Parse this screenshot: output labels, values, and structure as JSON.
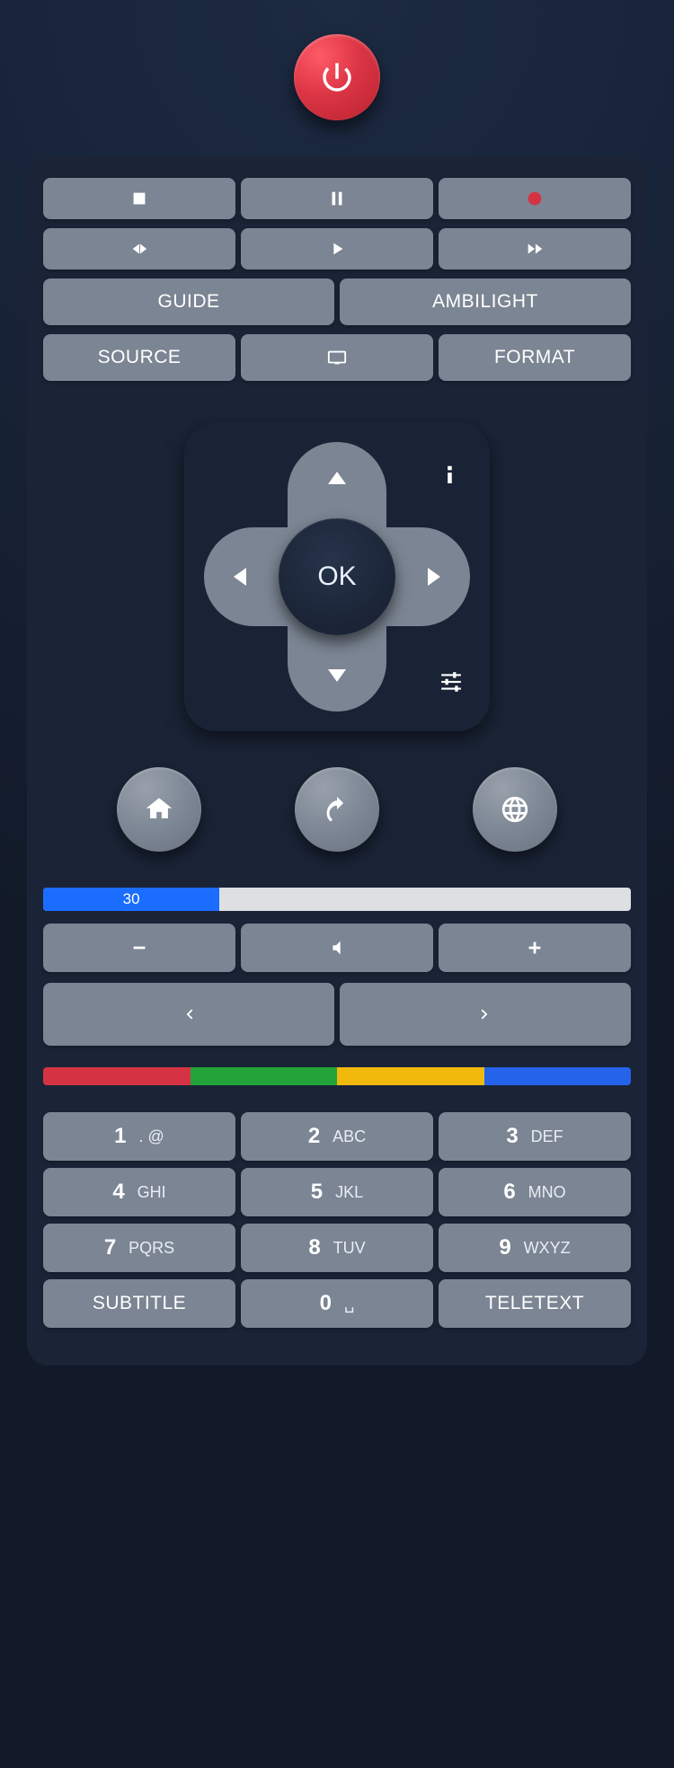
{
  "ok_label": "OK",
  "row3": {
    "guide": "GUIDE",
    "ambilight": "AMBILIGHT"
  },
  "row4": {
    "source": "SOURCE",
    "format": "FORMAT"
  },
  "volume": {
    "value": 30,
    "display": "30"
  },
  "keypad": {
    "k1": {
      "d": "1",
      "l": ". @"
    },
    "k2": {
      "d": "2",
      "l": "ABC"
    },
    "k3": {
      "d": "3",
      "l": "DEF"
    },
    "k4": {
      "d": "4",
      "l": "GHI"
    },
    "k5": {
      "d": "5",
      "l": "JKL"
    },
    "k6": {
      "d": "6",
      "l": "MNO"
    },
    "k7": {
      "d": "7",
      "l": "PQRS"
    },
    "k8": {
      "d": "8",
      "l": "TUV"
    },
    "k9": {
      "d": "9",
      "l": "WXYZ"
    },
    "k0": {
      "d": "0",
      "l": "␣"
    },
    "subtitle": "SUBTITLE",
    "teletext": "TELETEXT"
  }
}
